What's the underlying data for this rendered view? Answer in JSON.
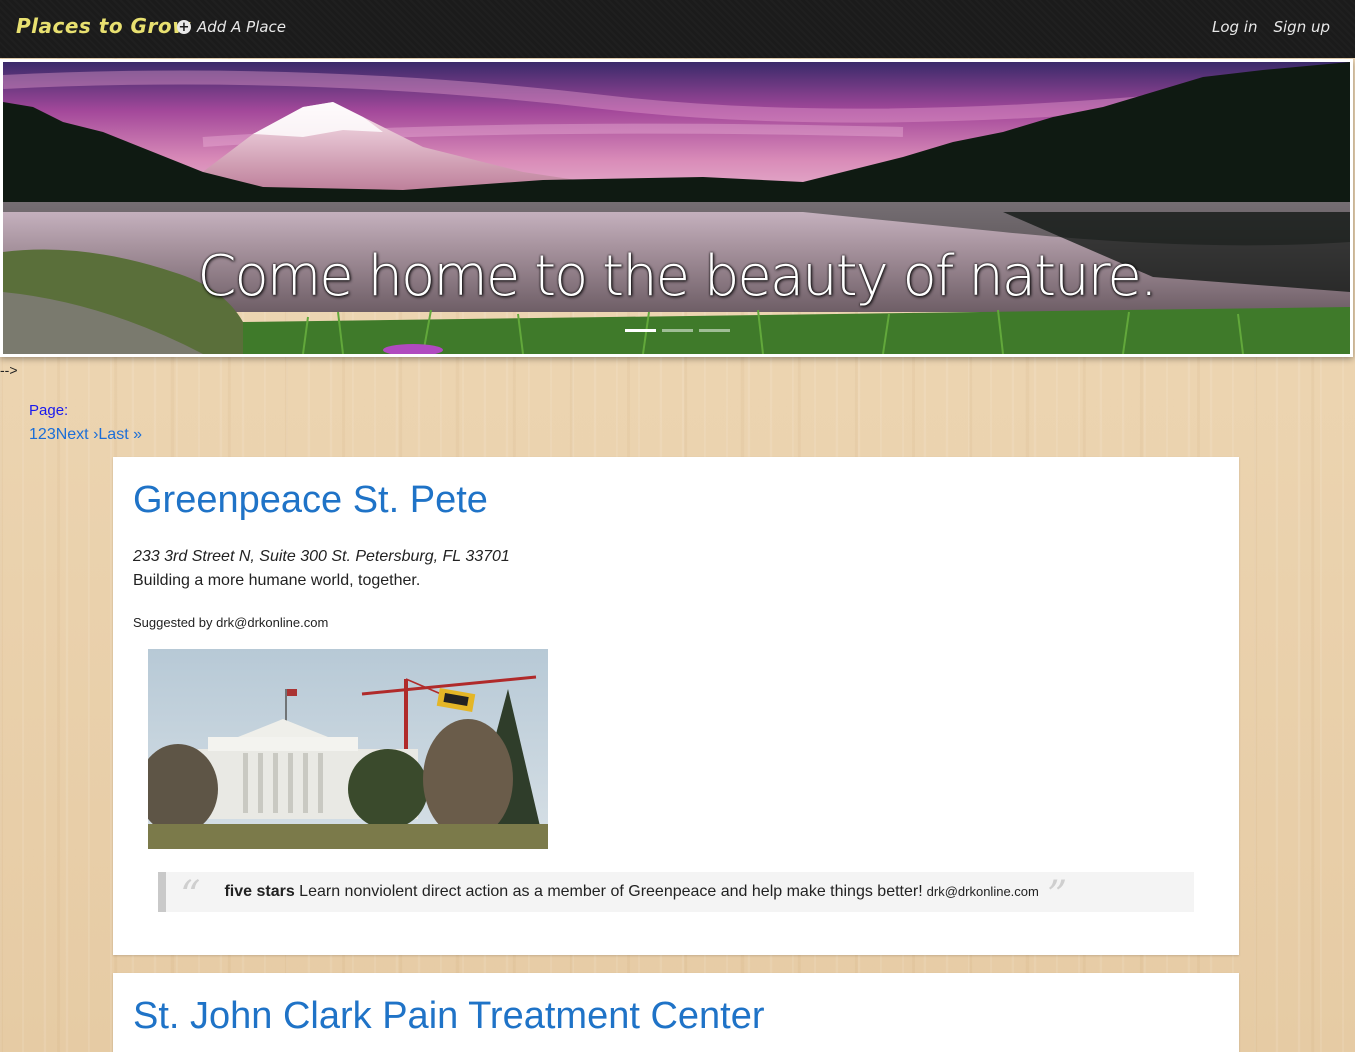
{
  "nav": {
    "brand": "Places to Grow",
    "add_place": "Add A Place",
    "login": "Log in",
    "signup": "Sign up"
  },
  "hero": {
    "caption": "Come home to the beauty of nature.",
    "slides": 3,
    "active_slide": 1
  },
  "stray_text": "-->",
  "pager": {
    "label": "Page:",
    "pages": [
      "1",
      "2",
      "3"
    ],
    "next": "Next ›",
    "last": "Last »"
  },
  "places": [
    {
      "name": "Greenpeace St. Pete",
      "address": "233 3rd Street N, Suite 300 St. Petersburg, FL 33701",
      "tagline": "Building a more humane world, together.",
      "suggested_by": "Suggested by drk@drkonline.com",
      "review": {
        "rating": "five stars",
        "text": "Learn nonviolent direct action as a member of Greenpeace and help make things better!",
        "author": "drk@drkonline.com"
      }
    },
    {
      "name": "St. John Clark Pain Treatment Center"
    }
  ]
}
